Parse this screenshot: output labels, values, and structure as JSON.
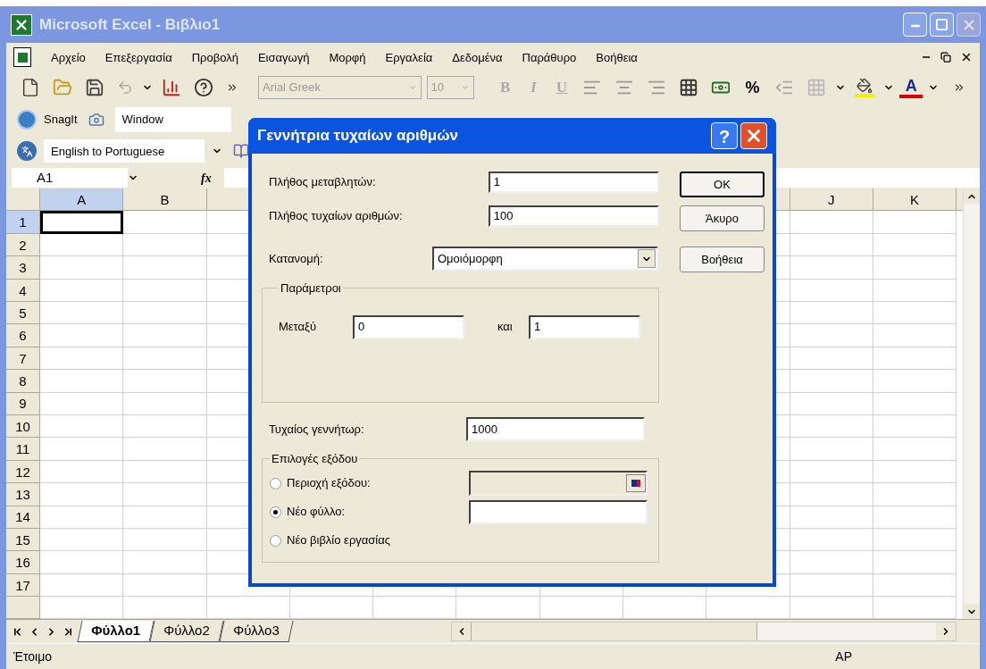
{
  "window": {
    "title": "Microsoft Excel - Βιβλιο1"
  },
  "menu": [
    "Αρχείο",
    "Επεξεργασία",
    "Προβολή",
    "Εισαγωγή",
    "Μορφή",
    "Εργαλεία",
    "Δεδομένα",
    "Παράθυρο",
    "Βοήθεια"
  ],
  "formatting_toolbar": {
    "font": "Arial Greek",
    "size": "10",
    "bold": "B",
    "italic": "I",
    "underline": "U",
    "percent": "%",
    "font_color": "A"
  },
  "snagit_toolbar": {
    "label": "SnagIt",
    "target": "Window"
  },
  "translate_toolbar": {
    "language_pair": "English to Portuguese"
  },
  "formula_bar": {
    "name_box": "A1",
    "fx": "fx"
  },
  "columns": [
    {
      "label": "A"
    },
    {
      "label": "B"
    },
    {
      "label": "J"
    },
    {
      "label": "K"
    }
  ],
  "rows": [
    "1",
    "2",
    "3",
    "4",
    "5",
    "6",
    "7",
    "8",
    "9",
    "10",
    "11",
    "12",
    "13",
    "14",
    "15",
    "16",
    "17"
  ],
  "sheet_tabs": [
    {
      "label": "Φύλλο1",
      "selected": true
    },
    {
      "label": "Φύλλο2",
      "selected": false
    },
    {
      "label": "Φύλλο3",
      "selected": false
    }
  ],
  "status_bar": {
    "status": "Έτοιμο",
    "indicator": "AP"
  },
  "dialog": {
    "title": "Γεννήτρια τυχαίων αριθμών",
    "variables_label": "Πλήθος μεταβλητών:",
    "variables": "1",
    "count_label": "Πλήθος τυχαίων αριθμών:",
    "count": "100",
    "distribution_label": "Κατανομή:",
    "distribution": "Ομοιόμορφη",
    "parameters_label": "Παράμετροι",
    "between_label": "Μεταξύ",
    "from": "0",
    "and_label": "και",
    "to": "1",
    "seed_label": "Τυχαίος γεννήτωρ:",
    "seed": "1000",
    "output_label": "Επιλογές εξόδου",
    "output_options": [
      {
        "label": "Περιοχή εξόδου:",
        "selected": false,
        "kind": "range"
      },
      {
        "label": "Νέο φύλλο:",
        "selected": true,
        "kind": "sheet"
      },
      {
        "label": "Νέο βιβλίο εργασίας",
        "selected": false,
        "kind": "workbook"
      }
    ],
    "buttons": [
      "OK",
      "Άκυρο",
      "Βοήθεια"
    ],
    "help": "?"
  }
}
